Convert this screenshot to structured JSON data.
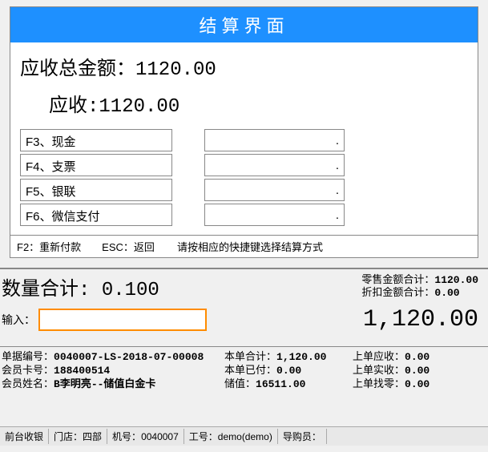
{
  "panel": {
    "title": "结算界面",
    "total_receivable_label": "应收总金额：",
    "total_receivable_value": "1120.00",
    "receivable_label": "应收:",
    "receivable_value": "1120.00",
    "methods": [
      {
        "label": "F3、现金",
        "value": "."
      },
      {
        "label": "F4、支票",
        "value": "."
      },
      {
        "label": "F5、银联",
        "value": "."
      },
      {
        "label": "F6、微信支付",
        "value": "."
      }
    ],
    "footer_hint_left": "F2：重新付款　　ESC：返回",
    "footer_hint_right": "请按相应的快捷键选择结算方式"
  },
  "totals": {
    "qty_label": "数量合计:",
    "qty_value": "0.100",
    "retail_label": "零售金额合计：",
    "retail_value": "1120.00",
    "discount_label": "折扣金额合计：",
    "discount_value": "0.00"
  },
  "input": {
    "label": "输入：",
    "value": "",
    "grand_total": "1,120.00"
  },
  "order": {
    "doc_no_label": "单据编号：",
    "doc_no_value": "0040007-LS-2018-07-00008",
    "card_no_label": "会员卡号：",
    "card_no_value": "188400514",
    "member_name_label": "会员姓名：",
    "member_name_value": "B李明亮--储值白金卡",
    "this_total_label": "本单合计：",
    "this_total_value": "1,120.00",
    "this_paid_label": "本单已付：",
    "this_paid_value": "0.00",
    "stored_label": "储值：",
    "stored_value": "16511.00",
    "prev_recv_label": "上单应收：",
    "prev_recv_value": "0.00",
    "prev_actual_label": "上单实收：",
    "prev_actual_value": "0.00",
    "prev_change_label": "上单找零：",
    "prev_change_value": "0.00"
  },
  "status": {
    "s1": "前台收银",
    "s2_label": "门店：",
    "s2_value": "四部",
    "s3_label": "机号：",
    "s3_value": "0040007",
    "s4_label": "工号：",
    "s4_value": "demo(demo)",
    "s5_label": "导购员："
  }
}
